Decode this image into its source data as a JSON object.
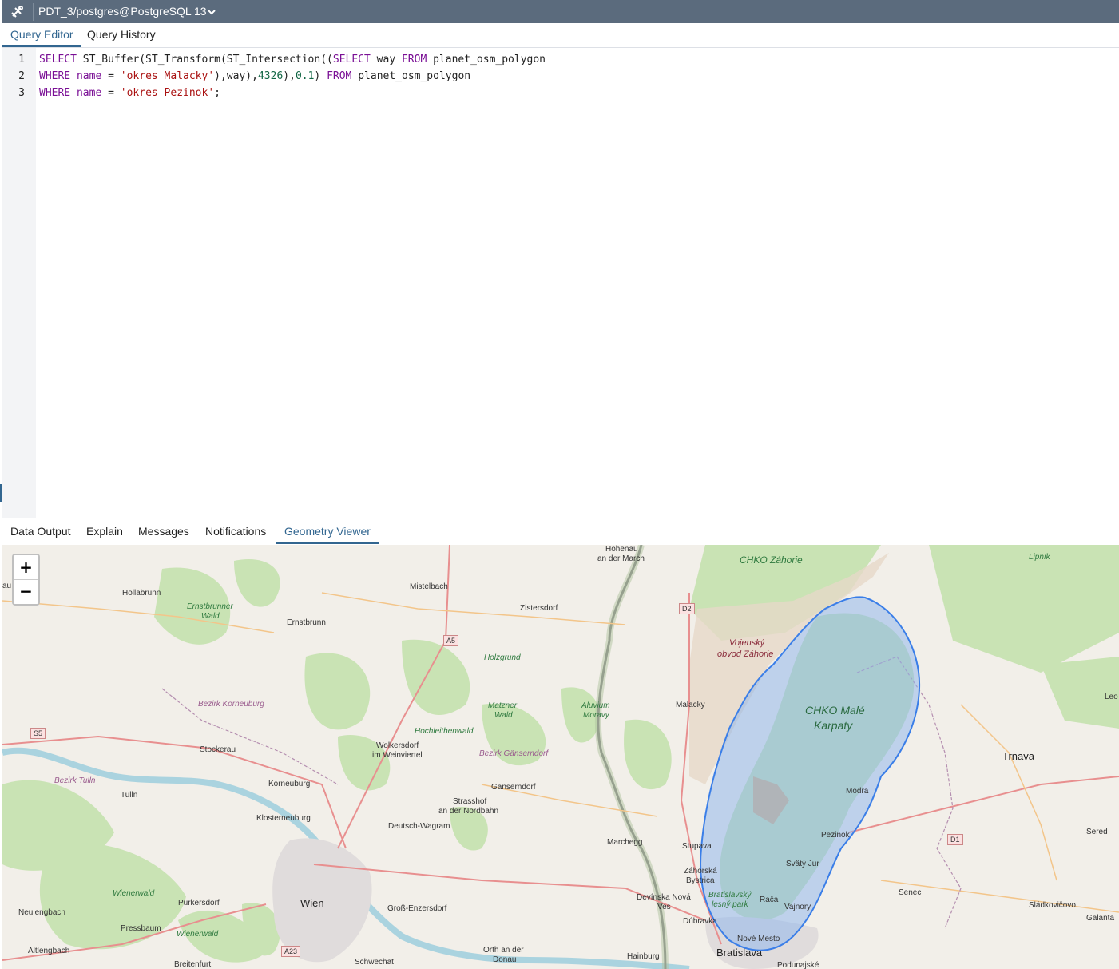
{
  "connection": {
    "label": "PDT_3/postgres@PostgreSQL 13"
  },
  "editor_tabs": [
    "Query Editor",
    "Query History"
  ],
  "editor": {
    "line_numbers": [
      "1",
      "2",
      "3"
    ],
    "lines": [
      [
        [
          "kw",
          "SELECT"
        ],
        [
          "plain",
          " ST_Buffer(ST_Transform(ST_Intersection(("
        ],
        [
          "kw",
          "SELECT"
        ],
        [
          "plain",
          " way "
        ],
        [
          "kw",
          "FROM"
        ],
        [
          "plain",
          " planet_osm_polygon"
        ]
      ],
      [
        [
          "kw",
          "WHERE"
        ],
        [
          "plain",
          " "
        ],
        [
          "kw",
          "name"
        ],
        [
          "plain",
          " = "
        ],
        [
          "str",
          "'okres Malacky'"
        ],
        [
          "plain",
          "),way),"
        ],
        [
          "num",
          "4326"
        ],
        [
          "plain",
          "),"
        ],
        [
          "num",
          "0.1"
        ],
        [
          "plain",
          ") "
        ],
        [
          "kw",
          "FROM"
        ],
        [
          "plain",
          " planet_osm_polygon"
        ]
      ],
      [
        [
          "kw",
          "WHERE"
        ],
        [
          "plain",
          " "
        ],
        [
          "kw",
          "name"
        ],
        [
          "plain",
          " = "
        ],
        [
          "str",
          "'okres Pezinok'"
        ],
        [
          "plain",
          ";"
        ]
      ]
    ]
  },
  "result_tabs": [
    "Data Output",
    "Explain",
    "Messages",
    "Notifications",
    "Geometry Viewer"
  ],
  "active_result_tab": "Geometry Viewer",
  "map": {
    "zoom_in": "+",
    "zoom_out": "−",
    "labels": {
      "hohenau": "Hohenau",
      "an_der_march": "an der March",
      "chko_zahorie": "CHKO Záhorie",
      "lipnik": "Lipník",
      "hollabrunn": "Hollabrunn",
      "mistelbach": "Mistelbach",
      "ernstbrunner": "Ernstbrunner",
      "wald": "Wald",
      "zistersdorf": "Zistersdorf",
      "ernstbrunn": "Ernstbrunn",
      "vojensky": "Vojenský",
      "obvod_zahorie": "obvod Záhorie",
      "holzgrund": "Holzgrund",
      "chko_male": "CHKO Malé",
      "karpaty": "Karpaty",
      "bezirk_korneuburg": "Bezirk Korneuburg",
      "matzner": "Matzner",
      "matzner_wald": "Wald",
      "aluvium": "Aluvium",
      "moravy": "Moravy",
      "malacky": "Malacky",
      "leo": "Leo",
      "hochleithenwald": "Hochleithenwald",
      "stockerau": "Stockerau",
      "wolkersdorf": "Wolkersdorf",
      "im_weinviertel": "im Weinviertel",
      "bezirk_ganserndorf": "Bezirk Gänserndorf",
      "trnava": "Trnava",
      "bezirk_tulln": "Bezirk Tulln",
      "korneuburg": "Korneuburg",
      "ganserndorf": "Gänserndorf",
      "tulln": "Tulln",
      "strasshof": "Strasshof",
      "an_der_nordbahn": "an der Nordbahn",
      "modra": "Modra",
      "klosterneuburg": "Klosterneuburg",
      "deutsch_wagram": "Deutsch-Wagram",
      "pezinok": "Pezinok",
      "sered": "Sered",
      "marchegg": "Marchegg",
      "stupava": "Stupava",
      "svaty_jur": "Svätý Jur",
      "zahorska": "Záhorská",
      "bystrica": "Bystrica",
      "wienerwald": "Wienerwald",
      "senec": "Senec",
      "devinska_nova": "Devínska Nová",
      "ves": "Ves",
      "bratislavsky": "Bratislavský",
      "lesny_park": "lesný park",
      "raca": "Rača",
      "purkersdorf": "Purkersdorf",
      "wien": "Wien",
      "gross_enzersdorf": "Groß-Enzersdorf",
      "vajnory": "Vajnory",
      "sladkovicovo": "Sládkovičovo",
      "neulengbach": "Neulengbach",
      "dubravka": "Dúbravka",
      "galanta": "Galanta",
      "pressbaum": "Pressbaum",
      "wienerwald2": "Wienerwald",
      "nove_mesto": "Nové Mesto",
      "altlengbach": "Altlengbach",
      "orth": "Orth an der",
      "donau": "Donau",
      "bratislava": "Bratislava",
      "hainburg": "Hainburg",
      "breitenfurt": "Breitenfurt",
      "schwechat": "Schwechat",
      "podunajske": "Podunajské",
      "au": "au"
    },
    "shields": {
      "d2": "D2",
      "a5": "A5",
      "s5": "S5",
      "d1": "D1",
      "a23": "A23"
    },
    "colors": {
      "buffer_fill": "#8ab4ee",
      "buffer_stroke": "#3a7ee8",
      "land": "#f2efe9",
      "forest": "#c9e3b4"
    }
  }
}
